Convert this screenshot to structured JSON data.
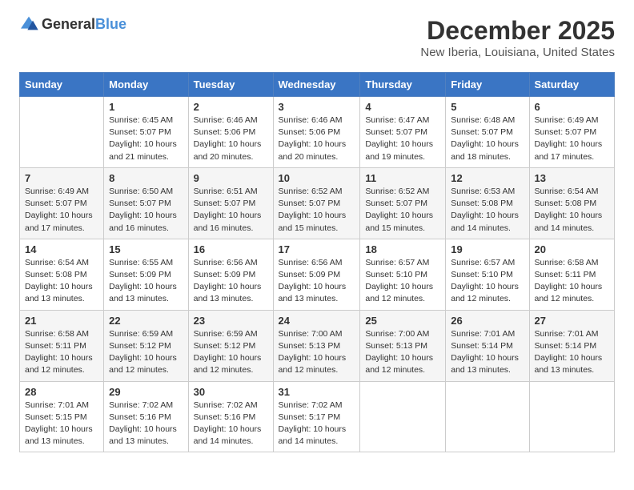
{
  "logo": {
    "general": "General",
    "blue": "Blue"
  },
  "title": "December 2025",
  "location": "New Iberia, Louisiana, United States",
  "headers": [
    "Sunday",
    "Monday",
    "Tuesday",
    "Wednesday",
    "Thursday",
    "Friday",
    "Saturday"
  ],
  "weeks": [
    [
      {
        "day": "",
        "info": ""
      },
      {
        "day": "1",
        "info": "Sunrise: 6:45 AM\nSunset: 5:07 PM\nDaylight: 10 hours\nand 21 minutes."
      },
      {
        "day": "2",
        "info": "Sunrise: 6:46 AM\nSunset: 5:06 PM\nDaylight: 10 hours\nand 20 minutes."
      },
      {
        "day": "3",
        "info": "Sunrise: 6:46 AM\nSunset: 5:06 PM\nDaylight: 10 hours\nand 20 minutes."
      },
      {
        "day": "4",
        "info": "Sunrise: 6:47 AM\nSunset: 5:07 PM\nDaylight: 10 hours\nand 19 minutes."
      },
      {
        "day": "5",
        "info": "Sunrise: 6:48 AM\nSunset: 5:07 PM\nDaylight: 10 hours\nand 18 minutes."
      },
      {
        "day": "6",
        "info": "Sunrise: 6:49 AM\nSunset: 5:07 PM\nDaylight: 10 hours\nand 17 minutes."
      }
    ],
    [
      {
        "day": "7",
        "info": "Sunrise: 6:49 AM\nSunset: 5:07 PM\nDaylight: 10 hours\nand 17 minutes."
      },
      {
        "day": "8",
        "info": "Sunrise: 6:50 AM\nSunset: 5:07 PM\nDaylight: 10 hours\nand 16 minutes."
      },
      {
        "day": "9",
        "info": "Sunrise: 6:51 AM\nSunset: 5:07 PM\nDaylight: 10 hours\nand 16 minutes."
      },
      {
        "day": "10",
        "info": "Sunrise: 6:52 AM\nSunset: 5:07 PM\nDaylight: 10 hours\nand 15 minutes."
      },
      {
        "day": "11",
        "info": "Sunrise: 6:52 AM\nSunset: 5:07 PM\nDaylight: 10 hours\nand 15 minutes."
      },
      {
        "day": "12",
        "info": "Sunrise: 6:53 AM\nSunset: 5:08 PM\nDaylight: 10 hours\nand 14 minutes."
      },
      {
        "day": "13",
        "info": "Sunrise: 6:54 AM\nSunset: 5:08 PM\nDaylight: 10 hours\nand 14 minutes."
      }
    ],
    [
      {
        "day": "14",
        "info": "Sunrise: 6:54 AM\nSunset: 5:08 PM\nDaylight: 10 hours\nand 13 minutes."
      },
      {
        "day": "15",
        "info": "Sunrise: 6:55 AM\nSunset: 5:09 PM\nDaylight: 10 hours\nand 13 minutes."
      },
      {
        "day": "16",
        "info": "Sunrise: 6:56 AM\nSunset: 5:09 PM\nDaylight: 10 hours\nand 13 minutes."
      },
      {
        "day": "17",
        "info": "Sunrise: 6:56 AM\nSunset: 5:09 PM\nDaylight: 10 hours\nand 13 minutes."
      },
      {
        "day": "18",
        "info": "Sunrise: 6:57 AM\nSunset: 5:10 PM\nDaylight: 10 hours\nand 12 minutes."
      },
      {
        "day": "19",
        "info": "Sunrise: 6:57 AM\nSunset: 5:10 PM\nDaylight: 10 hours\nand 12 minutes."
      },
      {
        "day": "20",
        "info": "Sunrise: 6:58 AM\nSunset: 5:11 PM\nDaylight: 10 hours\nand 12 minutes."
      }
    ],
    [
      {
        "day": "21",
        "info": "Sunrise: 6:58 AM\nSunset: 5:11 PM\nDaylight: 10 hours\nand 12 minutes."
      },
      {
        "day": "22",
        "info": "Sunrise: 6:59 AM\nSunset: 5:12 PM\nDaylight: 10 hours\nand 12 minutes."
      },
      {
        "day": "23",
        "info": "Sunrise: 6:59 AM\nSunset: 5:12 PM\nDaylight: 10 hours\nand 12 minutes."
      },
      {
        "day": "24",
        "info": "Sunrise: 7:00 AM\nSunset: 5:13 PM\nDaylight: 10 hours\nand 12 minutes."
      },
      {
        "day": "25",
        "info": "Sunrise: 7:00 AM\nSunset: 5:13 PM\nDaylight: 10 hours\nand 12 minutes."
      },
      {
        "day": "26",
        "info": "Sunrise: 7:01 AM\nSunset: 5:14 PM\nDaylight: 10 hours\nand 13 minutes."
      },
      {
        "day": "27",
        "info": "Sunrise: 7:01 AM\nSunset: 5:14 PM\nDaylight: 10 hours\nand 13 minutes."
      }
    ],
    [
      {
        "day": "28",
        "info": "Sunrise: 7:01 AM\nSunset: 5:15 PM\nDaylight: 10 hours\nand 13 minutes."
      },
      {
        "day": "29",
        "info": "Sunrise: 7:02 AM\nSunset: 5:16 PM\nDaylight: 10 hours\nand 13 minutes."
      },
      {
        "day": "30",
        "info": "Sunrise: 7:02 AM\nSunset: 5:16 PM\nDaylight: 10 hours\nand 14 minutes."
      },
      {
        "day": "31",
        "info": "Sunrise: 7:02 AM\nSunset: 5:17 PM\nDaylight: 10 hours\nand 14 minutes."
      },
      {
        "day": "",
        "info": ""
      },
      {
        "day": "",
        "info": ""
      },
      {
        "day": "",
        "info": ""
      }
    ]
  ]
}
